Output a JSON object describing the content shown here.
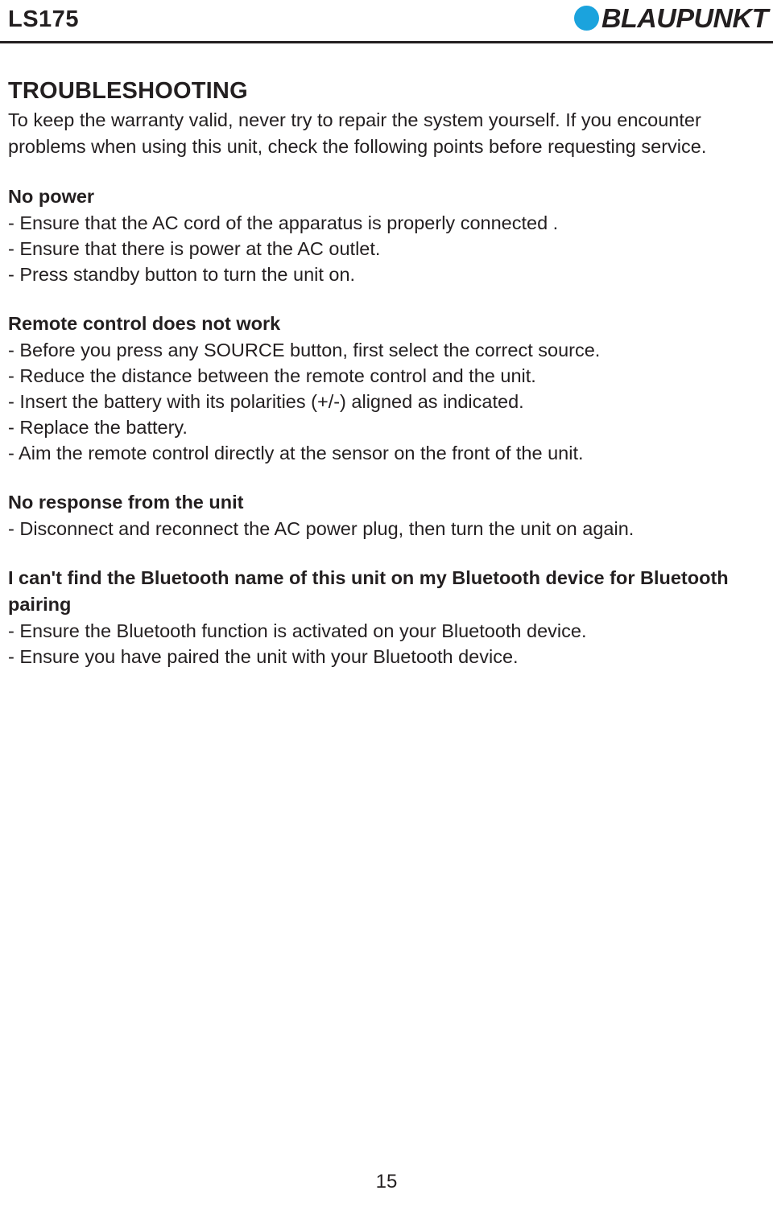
{
  "header": {
    "model_code": "LS175",
    "brand_name": "BLAUPUNKT",
    "brand_dot_color": "#1ba3dd",
    "rule_color": "#231f20"
  },
  "document": {
    "text_color": "#231f20",
    "background_color": "#ffffff",
    "page_number": "15"
  },
  "main": {
    "section_title": "TROUBLESHOOTING",
    "intro": "To keep the warranty valid, never try to repair the system yourself. If you encounter problems when using this unit, check the following points before requesting service.",
    "blocks": [
      {
        "heading": "No power",
        "items": [
          "- Ensure that the AC cord of the apparatus is properly connected .",
          "- Ensure that there is power at the AC outlet.",
          "- Press standby button to turn the unit on."
        ]
      },
      {
        "heading": "Remote control does not work",
        "items": [
          "- Before you press any SOURCE button, first select the correct source.",
          "- Reduce the distance between the remote control and the unit.",
          "- Insert the battery with its polarities (+/-) aligned as indicated.",
          "- Replace the battery.",
          "- Aim the remote control directly at the sensor on the front of the unit."
        ]
      },
      {
        "heading": "No response from the unit",
        "items": [
          "- Disconnect and reconnect the AC power plug, then turn the unit on again."
        ]
      },
      {
        "heading": "I can't find the Bluetooth name of this unit on my Bluetooth device for Bluetooth pairing",
        "items": [
          "- Ensure the Bluetooth function is activated on your Bluetooth device.",
          "- Ensure you have paired the unit with your Bluetooth device."
        ]
      }
    ]
  }
}
